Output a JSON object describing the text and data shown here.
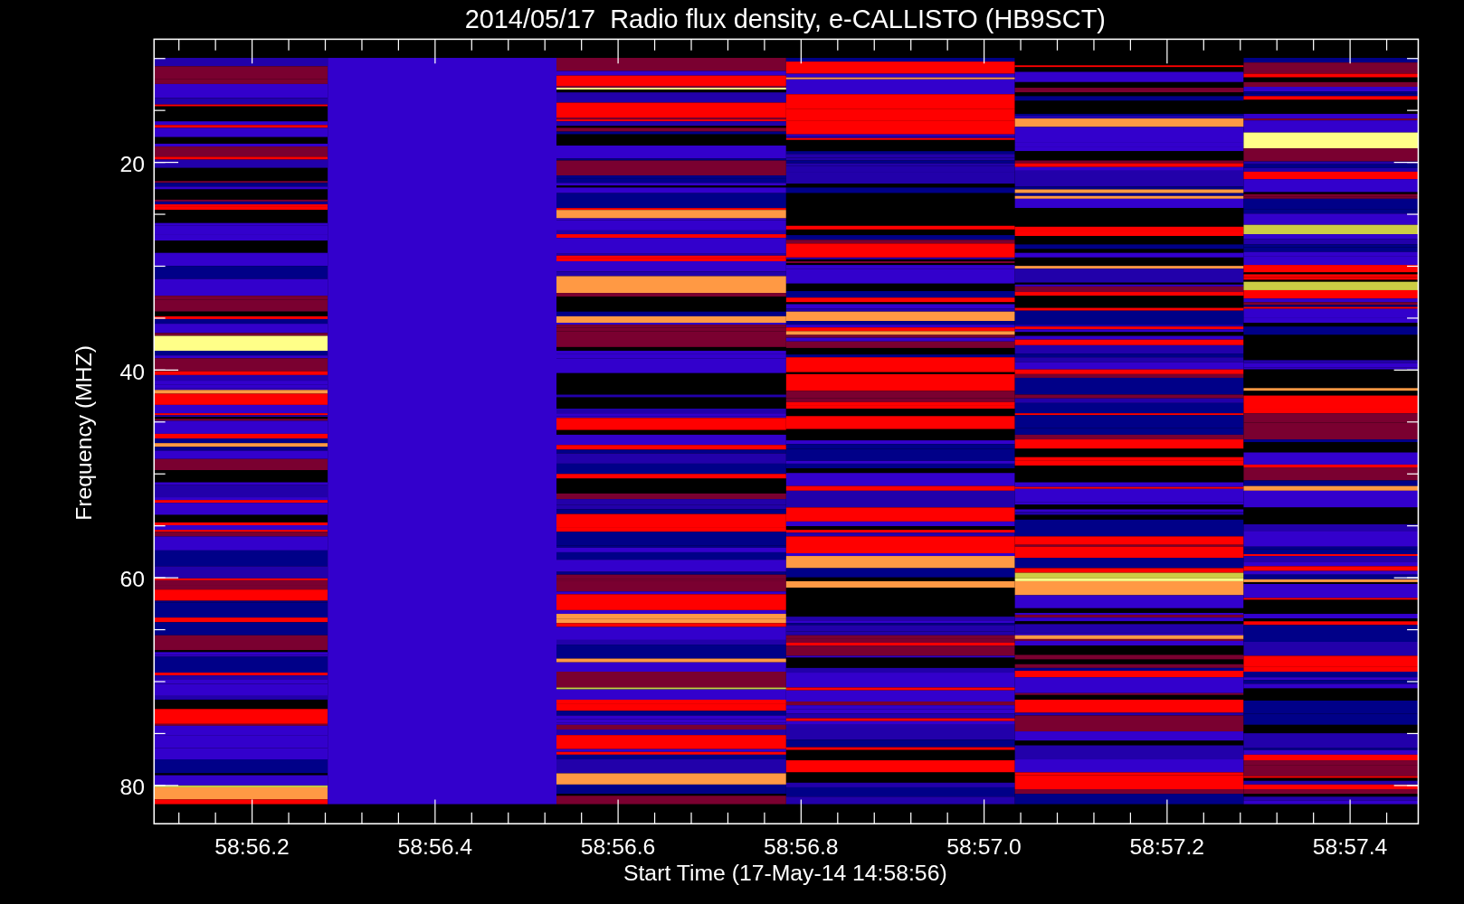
{
  "title": "2014/05/17  Radio flux density, e-CALLISTO (HB9SCT)",
  "y_axis": {
    "label": "Frequency (MHZ)",
    "ticks": [
      "20",
      "40",
      "60",
      "80"
    ]
  },
  "x_axis": {
    "label": "Start Time (17-May-14 14:58:56)",
    "ticks": [
      "58:56.2",
      "58:56.4",
      "58:56.6",
      "58:56.8",
      "58:57.0",
      "58:57.2",
      "58:57.4"
    ]
  }
}
